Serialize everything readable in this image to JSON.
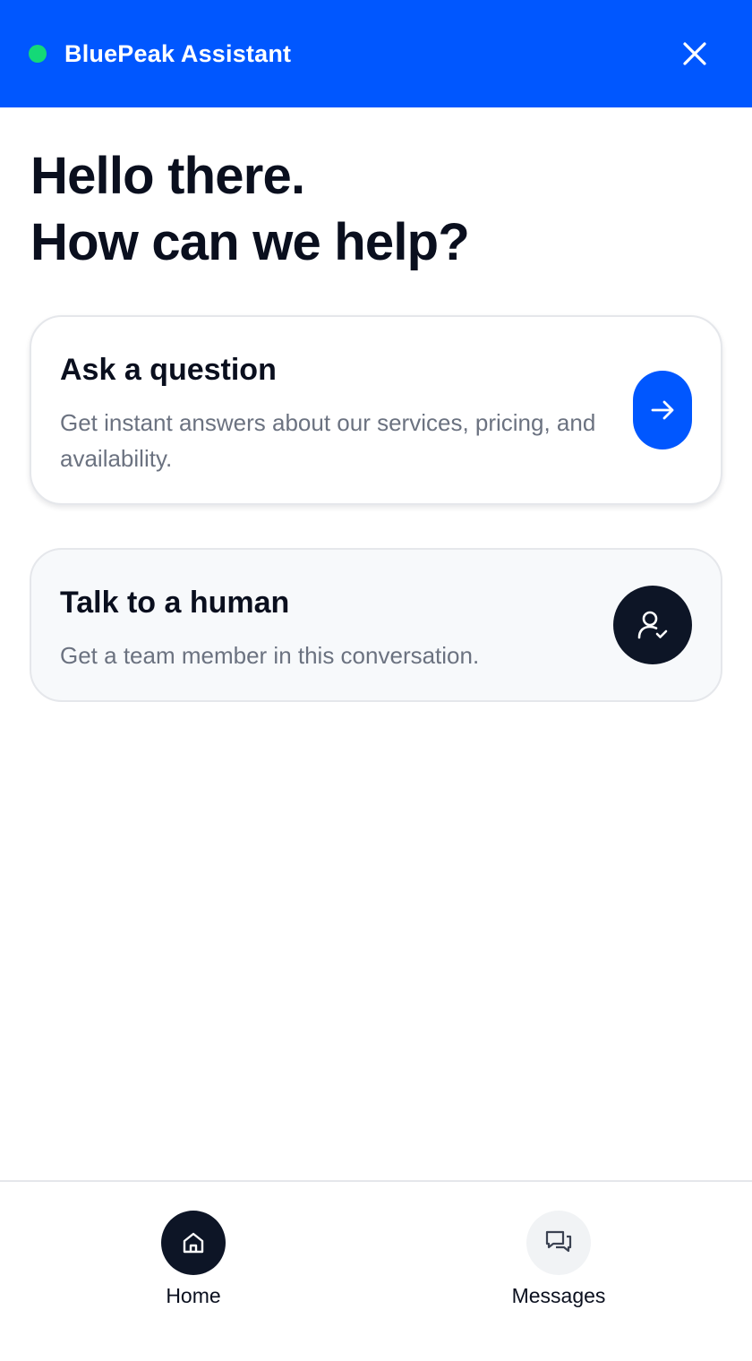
{
  "header": {
    "title": "BluePeak Assistant",
    "status_color": "#14d977",
    "background_color": "#0057ff",
    "close_icon": "close-icon"
  },
  "greeting": {
    "line1": "Hello there.",
    "line2": "How can we help?"
  },
  "cards": {
    "ask": {
      "title": "Ask a question",
      "description": "Get instant answers about our services, pricing, and availability.",
      "icon": "arrow-right-icon",
      "accent_color": "#0057ff"
    },
    "human": {
      "title": "Talk to a human",
      "description": "Get a team member in this conversation.",
      "icon": "user-check-icon",
      "accent_color": "#0d1526"
    }
  },
  "nav": {
    "home": {
      "label": "Home",
      "icon": "home-icon",
      "active": true
    },
    "messages": {
      "label": "Messages",
      "icon": "chat-icon",
      "active": false
    }
  }
}
